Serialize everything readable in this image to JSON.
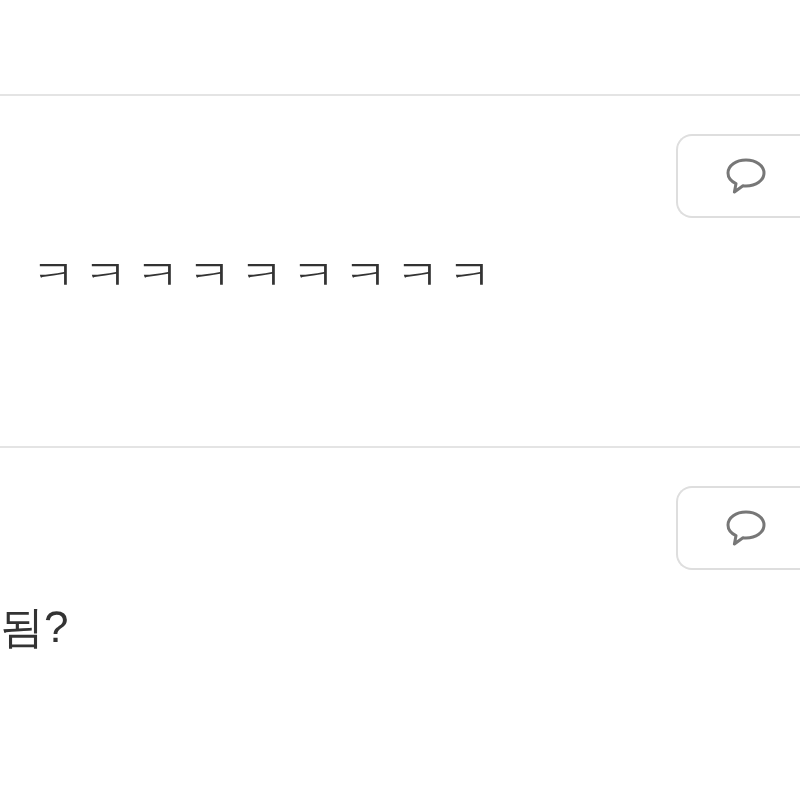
{
  "comments": [
    {
      "text": "ㅋㅋㅋㅋㅋㅋㅋㅋㅋ"
    },
    {
      "text": "됨?"
    }
  ]
}
